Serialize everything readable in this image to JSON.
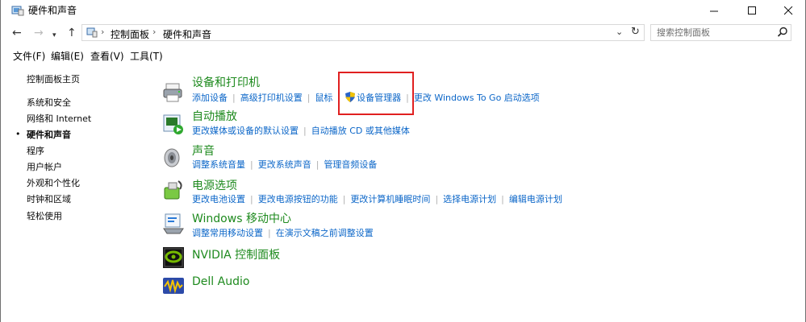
{
  "window": {
    "title": "硬件和声音"
  },
  "address": {
    "crumbs": [
      "控制面板",
      "硬件和声音"
    ],
    "sep": "›"
  },
  "search": {
    "placeholder": "搜索控制面板"
  },
  "menu": {
    "file": "文件(F)",
    "edit": "编辑(E)",
    "view": "查看(V)",
    "tools": "工具(T)"
  },
  "sidebar": {
    "home": "控制面板主页",
    "items": [
      "系统和安全",
      "网络和 Internet",
      "硬件和声音",
      "程序",
      "用户帐户",
      "外观和个性化",
      "时钟和区域",
      "轻松使用"
    ],
    "selected_marker": "•"
  },
  "categories": [
    {
      "title": "设备和打印机",
      "icon": "printer-icon",
      "links": [
        "添加设备",
        "高级打印机设置",
        "鼠标",
        "设备管理器",
        "更改 Windows To Go 启动选项"
      ]
    },
    {
      "title": "自动播放",
      "icon": "autoplay-icon",
      "links": [
        "更改媒体或设备的默认设置",
        "自动播放 CD 或其他媒体"
      ]
    },
    {
      "title": "声音",
      "icon": "speaker-icon",
      "links": [
        "调整系统音量",
        "更改系统声音",
        "管理音频设备"
      ]
    },
    {
      "title": "电源选项",
      "icon": "power-icon",
      "links": [
        "更改电池设置",
        "更改电源按钮的功能",
        "更改计算机睡眠时间",
        "选择电源计划",
        "编辑电源计划"
      ]
    },
    {
      "title": "Windows 移动中心",
      "icon": "mobility-center-icon",
      "links": [
        "调整常用移动设置",
        "在演示文稿之前调整设置"
      ]
    },
    {
      "title": "NVIDIA 控制面板",
      "icon": "nvidia-icon",
      "links": []
    },
    {
      "title": "Dell Audio",
      "icon": "dell-audio-icon",
      "links": []
    }
  ],
  "colors": {
    "title_green": "#1e8a1e",
    "link_blue": "#0b66c8",
    "highlight_red": "#e02020"
  }
}
